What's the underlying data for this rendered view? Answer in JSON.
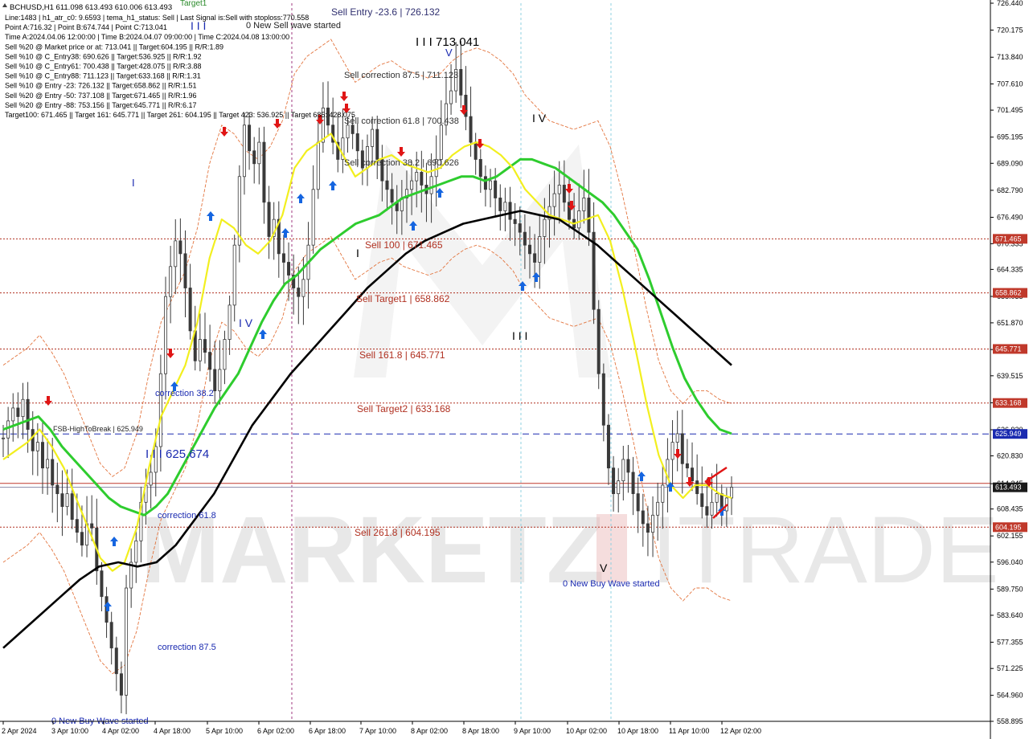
{
  "header": {
    "symbol_line": "BCHUSD,H1  611.098 613.493 610.006 613.493",
    "info_lines": [
      "Line:1483 | h1_atr_c0: 9.6593 | tema_h1_status: Sell | Last Signal is:Sell with stoploss:770.558",
      "Point A:716.32 | Point B:674.744 | Point C:713.041",
      "Time A:2024.04.06 12:00:00 | Time B:2024.04.07 09:00:00 | Time C:2024.04.08 13:00:00",
      "Sell %20 @ Market price or at: 713.041 || Target:604.195 || R/R:1.89",
      "Sell %10 @ C_Entry38: 690.626 || Target:536.925 || R/R:1.92",
      "Sell %10 @ C_Entry61: 700.438 || Target:428.075 || R/R:3.88",
      "Sell %10 @ C_Entry88: 711.123 || Target:633.168 || R/R:1.31",
      "Sell %10 @ Entry -23: 726.132 || Target:658.862 || R/R:1.51",
      "Sell %20 @ Entry -50: 737.108 || Target:671.465 || R/R:1.96",
      "Sell %20 @ Entry -88: 753.156 || Target:645.771 || R/R:6.17",
      "Target100: 671.465 || Target 161: 645.771 || Target 261: 604.195 || Target 423: 536.925 || Target 685: 428.075"
    ]
  },
  "chart_data": {
    "type": "candlestick",
    "symbol": "BCHUSD",
    "timeframe": "H1",
    "ohlc_last": {
      "open": 611.098,
      "high": 613.493,
      "low": 610.006,
      "close": 613.493
    },
    "ylim": [
      558.895,
      726.44
    ],
    "y_ticks": [
      "726.440",
      "720.175",
      "713.840",
      "707.610",
      "701.495",
      "695.195",
      "689.090",
      "682.790",
      "676.490",
      "670.335",
      "664.335",
      "658.035",
      "651.870",
      "645.640",
      "639.515",
      "633.215",
      "626.920",
      "620.830",
      "614.345",
      "608.435",
      "602.155",
      "596.040",
      "589.750",
      "583.640",
      "577.355",
      "571.225",
      "564.960",
      "558.895"
    ],
    "x_ticks": [
      "2 Apr 2024",
      "3 Apr 10:00",
      "4 Apr 02:00",
      "4 Apr 18:00",
      "5 Apr 10:00",
      "6 Apr 02:00",
      "6 Apr 18:00",
      "7 Apr 10:00",
      "8 Apr 02:00",
      "8 Apr 18:00",
      "9 Apr 10:00",
      "10 Apr 02:00",
      "10 Apr 18:00",
      "11 Apr 10:00",
      "12 Apr 02:00"
    ],
    "close_series": [
      625,
      629,
      632,
      630,
      634,
      627,
      622,
      624,
      618,
      620,
      614,
      612,
      609,
      612,
      606,
      603,
      600,
      605,
      604,
      594,
      588,
      582,
      576,
      570,
      565,
      590,
      596,
      601,
      610,
      614,
      617,
      623,
      640,
      658,
      665,
      671,
      668,
      660,
      650,
      643,
      648,
      645,
      641,
      636,
      641,
      648,
      656,
      670,
      686,
      698,
      692,
      689,
      694,
      680,
      672,
      676,
      668,
      666,
      663,
      660,
      658,
      662,
      670,
      683,
      694,
      702,
      698,
      694,
      690,
      695,
      698,
      696,
      692,
      688,
      693,
      697,
      690,
      685,
      683,
      680,
      678,
      681,
      683,
      685,
      687,
      684,
      682,
      686,
      690,
      698,
      703,
      706,
      711,
      705,
      700,
      694,
      690,
      686,
      683,
      685,
      681,
      678,
      680,
      676,
      675,
      673,
      670,
      668,
      666,
      672,
      676,
      679,
      682,
      684,
      680,
      676,
      674,
      678,
      681,
      673,
      655,
      640,
      628,
      618,
      612,
      615,
      620,
      617,
      612,
      608,
      605,
      603,
      607,
      610,
      614,
      620,
      624,
      626,
      619,
      618,
      615,
      612,
      609,
      607,
      610,
      612,
      608,
      611,
      613.493
    ],
    "ema_green": [
      627,
      628,
      629,
      630,
      627,
      623,
      620,
      617,
      614,
      611,
      609,
      608,
      607,
      609,
      612,
      617,
      622,
      627,
      632,
      636,
      640,
      646,
      652,
      657,
      661,
      663,
      666,
      669,
      671,
      673,
      675,
      676,
      677,
      679,
      681,
      682,
      683,
      684,
      685,
      686,
      686,
      685,
      686,
      688,
      690,
      690,
      689,
      688,
      686,
      684,
      682,
      680,
      677,
      673,
      669,
      662,
      654,
      646,
      639,
      634,
      630,
      627,
      626
    ],
    "ema_yellow": [
      620,
      622,
      624,
      627,
      623,
      618,
      611,
      604,
      597,
      594,
      596,
      604,
      618,
      630,
      636,
      642,
      652,
      667,
      676,
      674,
      670,
      668,
      671,
      677,
      688,
      692,
      694,
      696,
      691,
      686,
      688,
      690,
      691,
      689,
      688,
      687,
      688,
      691,
      693,
      694,
      693,
      691,
      688,
      683,
      680,
      677,
      676,
      675,
      676,
      677,
      671,
      660,
      647,
      633,
      621,
      614,
      611,
      614,
      614,
      612,
      611
    ],
    "sma_black": [
      576,
      580,
      584,
      588,
      592,
      595,
      596,
      595,
      596,
      600,
      606,
      612,
      620,
      628,
      634,
      640,
      645,
      650,
      655,
      660,
      664,
      668,
      671,
      673,
      675,
      676,
      677,
      678,
      677,
      676,
      673,
      670,
      666,
      662,
      658,
      654,
      650,
      646,
      642
    ],
    "levels": [
      {
        "name": "Sell Entry -23.6",
        "value": 726.132,
        "label": "Sell Entry -23.6 | 726.132"
      },
      {
        "name": "Sell correction 87.5",
        "value": 711.123,
        "label": "Sell correction 87.5 | 711.123"
      },
      {
        "name": "Sell correction 61.8",
        "value": 700.438,
        "label": "Sell correction 61.8 | 700.438"
      },
      {
        "name": "Sell correction 38.2",
        "value": 690.626,
        "label": "Sell correction 38.2 | 690.626"
      },
      {
        "name": "Sell 100",
        "value": 671.465,
        "label": "Sell 100 | 671.465"
      },
      {
        "name": "Sell Target1",
        "value": 658.862,
        "label": "Sell Target1 | 658.862"
      },
      {
        "name": "Sell 161.8",
        "value": 645.771,
        "label": "Sell 161.8 | 645.771"
      },
      {
        "name": "Sell Target2",
        "value": 633.168,
        "label": "Sell Target2 | 633.168"
      },
      {
        "name": "Sell 261.8",
        "value": 604.195,
        "label": "Sell  261.8 | 604.195"
      }
    ],
    "fsb_high_to_break": {
      "label": "FSB-HighToBreak | 625.949",
      "value": 625.949
    },
    "current_price_line": 614.417,
    "price_tags": [
      {
        "value": "726.440",
        "color": "#000000",
        "highlight": false
      },
      {
        "value": "671.465",
        "color": "#c0392b",
        "highlight": true
      },
      {
        "value": "658.862",
        "color": "#c0392b",
        "highlight": true
      },
      {
        "value": "645.771",
        "color": "#c0392b",
        "highlight": true
      },
      {
        "value": "633.168",
        "color": "#c0392b",
        "highlight": true
      },
      {
        "value": "625.949",
        "color": "#1a2ab0",
        "highlight": true
      },
      {
        "value": "613.493",
        "color": "#1a1a1a",
        "highlight": true
      },
      {
        "value": "604.195",
        "color": "#c0392b",
        "highlight": true
      }
    ],
    "annotations": {
      "sell_entry": "Sell Entry -23.6 | 726.132",
      "new_sell_wave": "0 New Sell wave started",
      "iii_713": "I I I 713.041",
      "iii_625": "I I I 625.674",
      "iv_top": "I V",
      "iv_mid": "I V",
      "iii_mid": "I I I",
      "i_mark": "I",
      "iii_top_left": "I I I",
      "correction_38": "correction 38.2",
      "correction_61": "correction 61.8",
      "correction_87": "correction 87.5",
      "new_buy_wave_1": "0 New Buy Wave started",
      "new_buy_wave_2": "0 New Buy Wave started",
      "v_mark": "V",
      "target1_top": "Target1"
    },
    "colors": {
      "ema_green": "#2ecc2e",
      "ema_yellow": "#f2ef1f",
      "sma_black": "#000000",
      "level_red": "#b03020",
      "fsb_blue": "#1a2ab0",
      "candle": "#3a3a3a",
      "envelope": "#e0662a"
    },
    "watermark": "MARKETZITRADE"
  }
}
